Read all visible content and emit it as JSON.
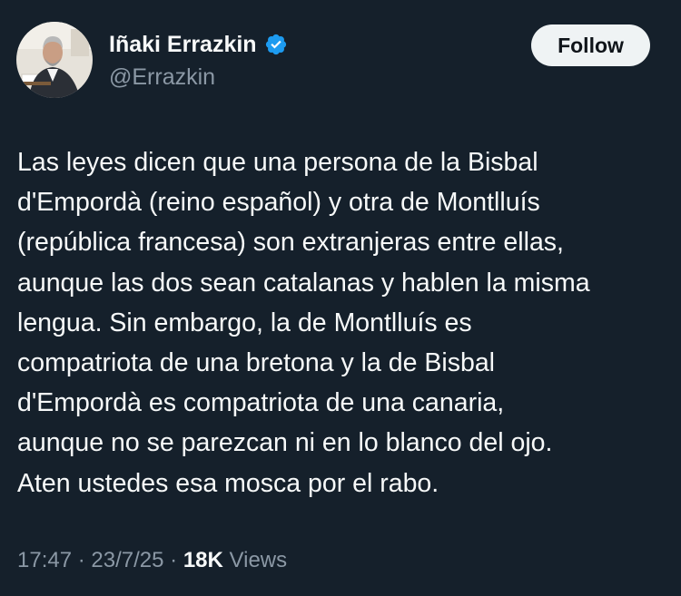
{
  "author": {
    "display_name": "Iñaki Errazkin",
    "handle": "@Errazkin",
    "verified_icon": "verified-badge-icon"
  },
  "follow_button": {
    "label": "Follow"
  },
  "tweet": {
    "lines": [
      "Las leyes dicen que una persona de la Bisbal",
      "d'Empordà (reino español) y otra de Montlluís",
      "(república francesa) son extranjeras entre ellas,",
      "aunque las dos sean catalanas y hablen la misma",
      "lengua. Sin embargo, la de Montlluís es",
      "compatriota de una bretona y la de Bisbal",
      "d'Empordà es compatriota de una canaria,",
      "aunque no se parezcan ni en lo blanco del ojo.",
      "Aten ustedes esa mosca por el rabo."
    ]
  },
  "meta": {
    "time": "17:47",
    "separator": "·",
    "date": "23/7/25",
    "views_count": "18K",
    "views_label": "Views"
  },
  "colors": {
    "background": "#15202b",
    "text_primary": "#f7f9f9",
    "text_secondary": "#8b98a5",
    "verified_blue": "#1d9bf0",
    "follow_bg": "#eff3f4"
  }
}
